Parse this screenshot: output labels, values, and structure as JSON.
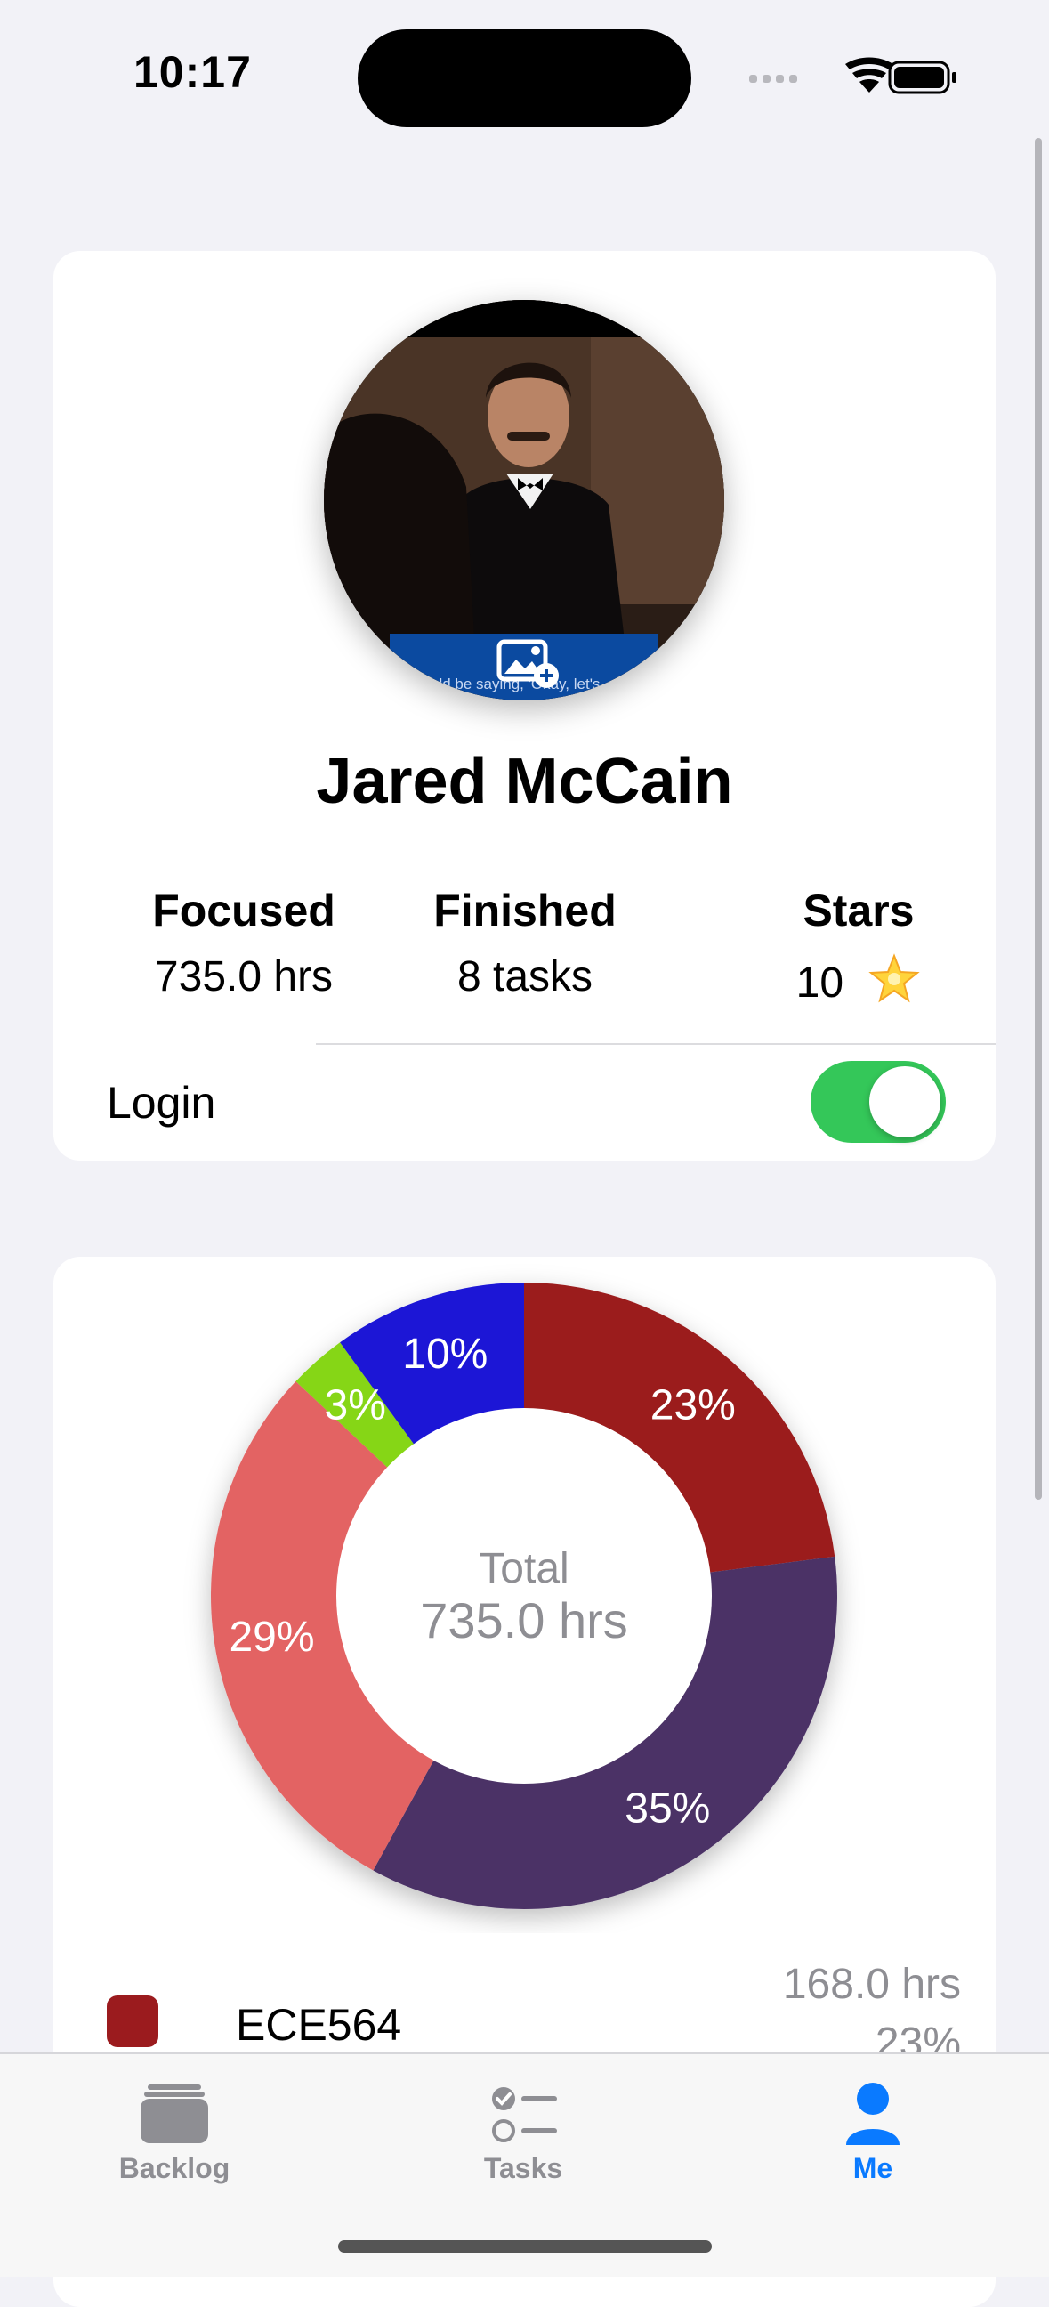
{
  "status_bar": {
    "time": "10:17"
  },
  "profile": {
    "name": "Jared McCain",
    "avatar_caption": "uld be saying, 'Okay, let's",
    "stats": [
      {
        "label": "Focused",
        "value": "735.0 hrs"
      },
      {
        "label": "Finished",
        "value": "8 tasks"
      },
      {
        "label": "Stars",
        "value": "10",
        "icon": "glowing-star-icon"
      }
    ],
    "login": {
      "label": "Login",
      "enabled": true
    }
  },
  "chart_data": {
    "type": "pie",
    "title": "",
    "center_label": "Total",
    "center_value": "735.0 hrs",
    "slices": [
      {
        "label": "23%",
        "value": 23,
        "color": "#9B1B1E"
      },
      {
        "label": "35%",
        "value": 35,
        "color": "#4B3266"
      },
      {
        "label": "29%",
        "value": 29,
        "color": "#E36464"
      },
      {
        "label": "3%",
        "value": 3,
        "color": "#86D614"
      },
      {
        "label": "10%",
        "value": 10,
        "color": "#1A14D6"
      }
    ]
  },
  "legend": [
    {
      "name": "ECE564",
      "hours": "168.0 hrs",
      "percent": "23%",
      "color": "#9B1B1E"
    }
  ],
  "tab_bar": {
    "tabs": [
      {
        "label": "Backlog",
        "icon": "tray-stack-icon",
        "selected": false
      },
      {
        "label": "Tasks",
        "icon": "checklist-icon",
        "selected": false
      },
      {
        "label": "Me",
        "icon": "person-icon",
        "selected": true
      }
    ],
    "active_color": "#0A7AFF"
  }
}
